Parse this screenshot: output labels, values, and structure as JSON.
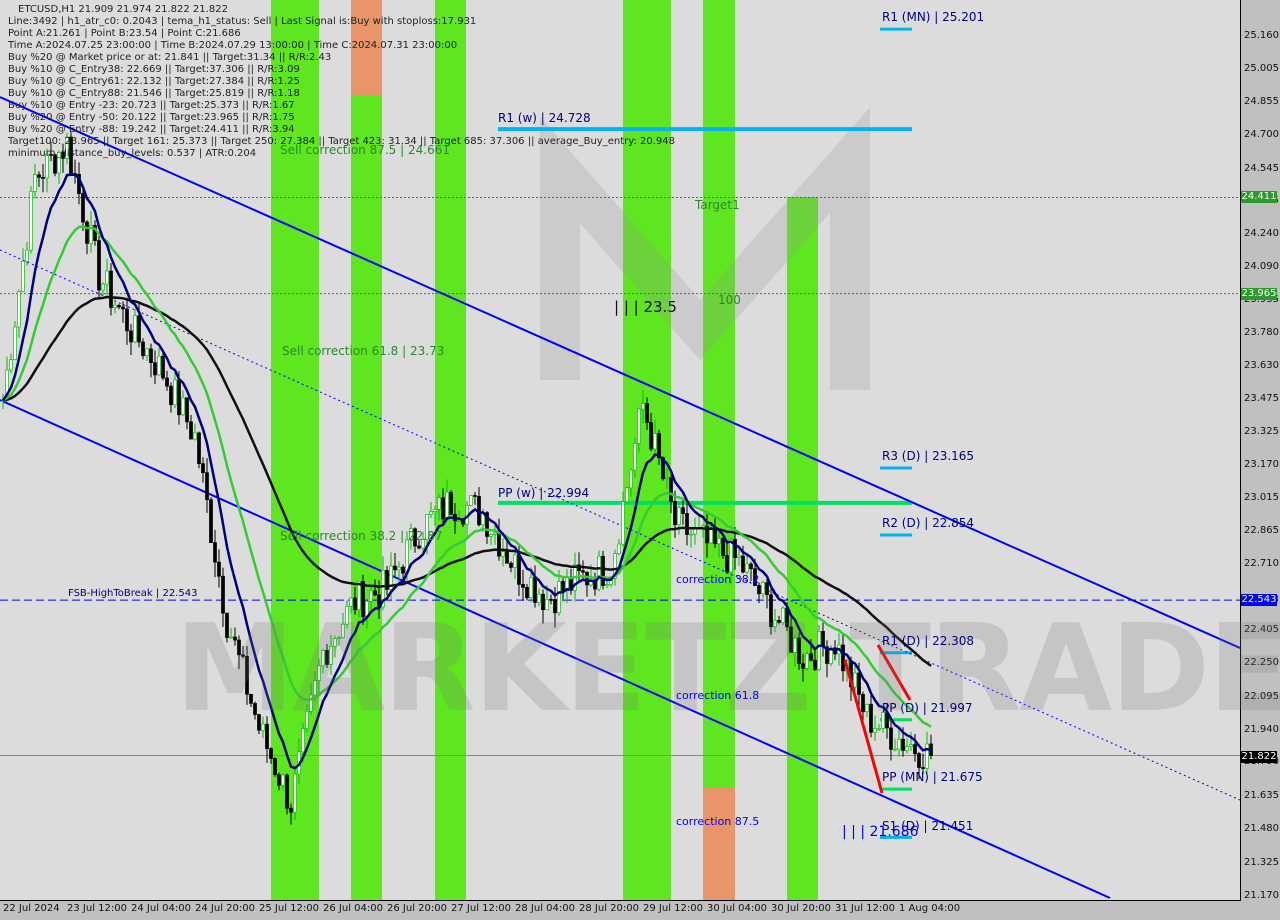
{
  "header": {
    "symbol_line": "ETCUSD,H1  21.909 21.974 21.822 21.822",
    "lines": [
      "Line:3492 | h1_atr_c0: 0.2043 | tema_h1_status: Sell | Last Signal is:Buy with stoploss:17.931",
      "Point A:21.261 | Point B:23.54 | Point C:21.686",
      "Time A:2024.07.25 23:00:00 | Time B:2024.07.29 13:00:00 | Time C:2024.07.31 23:00:00",
      "Buy %20 @ Market price or at: 21.841 || Target:31.34 || R/R:2.43",
      "Buy %10 @ C_Entry38: 22.669 || Target:37.306 || R/R:3.09",
      "Buy %10 @ C_Entry61: 22.132 || Target:27.384 || R/R:1.25",
      "Buy %10 @ C_Entry88: 21.546 || Target:25.819 || R/R:1.18",
      "Buy %10 @ Entry -23: 20.723 || Target:25.373 || R/R:1.67",
      "Buy %20 @ Entry -50: 20.122 || Target:23.965 || R/R:1.75",
      "Buy %20 @ Entry -88: 19.242 || Target:24.411 || R/R:3.94",
      "Target100: 23.965 || Target 161: 25.373 || Target 250: 27.384 || Target 423: 31.34 || Target 685: 37.306 || average_Buy_entry: 20.948",
      "minimum_distance_buy_levels: 0.537 | ATR:0.204"
    ]
  },
  "annotations": {
    "r1_mn": "R1 (MN) | 25.201",
    "r1_w": "R1 (w) | 24.728",
    "pp_w": "PP (w) | 22.994",
    "r3_d": "R3 (D) | 23.165",
    "r2_d": "R2 (D) | 22.854",
    "r1_d": "R1 (D) | 22.308",
    "pp_d": "PP (D) | 21.997",
    "pp_mn": "PP (MN) | 21.675",
    "s1_d": "S1 (D) | 21.451",
    "fsb": "FSB-HighToBreak | 22.543",
    "target1": "Target1",
    "t100": "100",
    "point_b": "| | | 23.5",
    "point_c": "| | | 21.686",
    "sell_875": "Sell correction 87.5 | 24.661",
    "sell_618": "Sell correction 61.8 | 23.73",
    "sell_382": "Sell correction 38.2 | 22.87",
    "corr_382": "correction 38.2",
    "corr_618": "correction 61.8",
    "corr_875": "correction 87.5",
    "watermark": "MARKETZ TRADE"
  },
  "price_badges": {
    "b1": "24.411",
    "b2": "23.965",
    "b3": "22.543",
    "current": "21.822"
  },
  "colors": {
    "bull": "#00c000",
    "bear": "#000000",
    "band_green": "#5ee61e",
    "band_orange": "#e8956a",
    "channel": "#0000ff",
    "pivot": "#00b4f0",
    "pp_green": "#00e060",
    "fast_ma": "#000080",
    "mid_ma": "#33cc33",
    "slow_ma": "#111111",
    "signal_red": "#ff0000"
  },
  "chart_data": {
    "type": "candlestick",
    "symbol": "ETCUSD",
    "timeframe": "H1",
    "ylim": [
      21.17,
      25.16
    ],
    "y_ticks": [
      "25.160",
      "25.005",
      "24.855",
      "24.700",
      "24.545",
      "24.395",
      "24.240",
      "24.090",
      "23.935",
      "23.780",
      "23.630",
      "23.475",
      "23.325",
      "23.170",
      "23.015",
      "22.865",
      "22.710",
      "22.543",
      "22.405",
      "22.250",
      "22.095",
      "21.940",
      "21.790",
      "21.635",
      "21.480",
      "21.325",
      "21.170"
    ],
    "x_ticks": [
      "22 Jul 2024",
      "23 Jul 12:00",
      "24 Jul 04:00",
      "24 Jul 20:00",
      "25 Jul 12:00",
      "26 Jul 04:00",
      "26 Jul 20:00",
      "27 Jul 12:00",
      "28 Jul 04:00",
      "28 Jul 20:00",
      "29 Jul 12:00",
      "30 Jul 04:00",
      "30 Jul 20:00",
      "31 Jul 12:00",
      "1 Aug 04:00"
    ],
    "close_every_8_bars": [
      23.47,
      24.5,
      24.66,
      24.05,
      23.8,
      23.6,
      23.3,
      22.45,
      21.95,
      21.6,
      22.3,
      22.54,
      22.6,
      22.87,
      23.0,
      22.95,
      22.7,
      22.55,
      22.64,
      22.7,
      23.45,
      22.9,
      22.8,
      22.72,
      22.5,
      22.28,
      22.35,
      22.0,
      21.9,
      21.822
    ],
    "levels": {
      "r1_mn": 25.201,
      "r1_w": 24.728,
      "target_24411": 24.411,
      "target_23965": 23.965,
      "r3_d": 23.165,
      "pp_w": 22.994,
      "r2_d": 22.854,
      "fsb": 22.543,
      "r1_d": 22.308,
      "pp_d": 21.997,
      "current": 21.822,
      "pp_mn": 21.675,
      "s1_d": 21.451
    }
  }
}
